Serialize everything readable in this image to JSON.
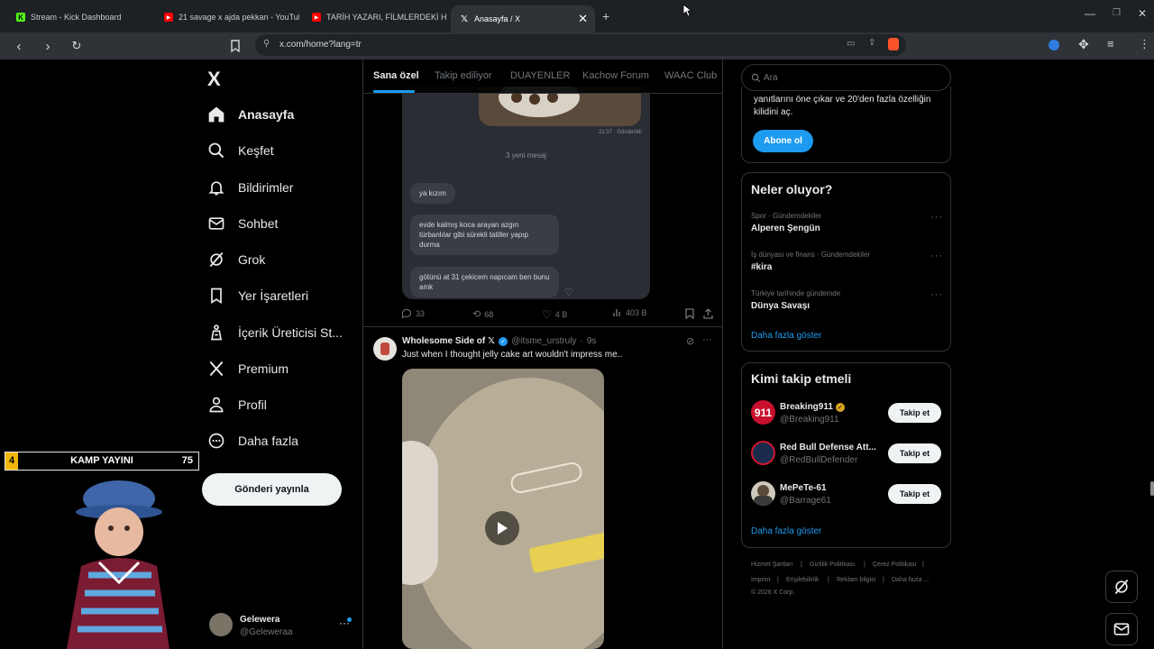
{
  "browser": {
    "tabs": [
      {
        "title": "Stream - Kick Dashboard",
        "favicon": "kick-icon"
      },
      {
        "title": "21 savage x ajda pekkan - YouTube",
        "favicon": "youtube-icon"
      },
      {
        "title": "TARİH YAZARI, FİLMLERDEKİ HİTLER",
        "favicon": "youtube-icon"
      },
      {
        "title": "Anasayfa / X",
        "favicon": "x-icon"
      }
    ],
    "url": "x.com/home?lang=tr"
  },
  "sidebar": {
    "logo": "X",
    "items": [
      {
        "label": "Anasayfa",
        "icon": "home-icon"
      },
      {
        "label": "Keşfet",
        "icon": "search-icon"
      },
      {
        "label": "Bildirimler",
        "icon": "bell-icon"
      },
      {
        "label": "Sohbet",
        "icon": "mail-icon"
      },
      {
        "label": "Grok",
        "icon": "grok-icon"
      },
      {
        "label": "Yer İşaretleri",
        "icon": "bookmark-icon"
      },
      {
        "label": "İçerik Üreticisi St...",
        "icon": "creator-icon"
      },
      {
        "label": "Premium",
        "icon": "x-icon"
      },
      {
        "label": "Profil",
        "icon": "person-icon"
      },
      {
        "label": "Daha fazla",
        "icon": "more-circle-icon"
      }
    ],
    "post_button": "Gönderi yayınla",
    "account": {
      "name": "Gelewera",
      "handle": "@Geleweraa"
    }
  },
  "overlay": {
    "banner_label": "KAMP YAYINI",
    "banner_left": "4",
    "banner_right": "75"
  },
  "feed": {
    "tabs": [
      "Sana özel",
      "Takip ediliyor",
      "DUAYENLER",
      "Kachow Forum",
      "WAAC Club"
    ],
    "post1": {
      "chat": {
        "time": "21:37 · Gönderildi",
        "new_messages": "3 yeni mesaj",
        "messages": [
          "ya kızım",
          "evde kalmış koca arayan azgın türbanlılar gibi sürekli tatiller yapıp durma",
          "götünü at 31 çekicem napıcam ben bunu amk"
        ]
      },
      "stats": {
        "replies": "33",
        "reposts": "68",
        "likes": "4 B",
        "views": "403 B"
      }
    },
    "post2": {
      "author": "Wholesome Side of 𝕏",
      "handle": "@itsme_urstruly",
      "time": "9s",
      "text": "Just when I thought jelly cake art wouldn't impress me.."
    }
  },
  "right": {
    "search_placeholder": "Ara",
    "premium": {
      "text_line1": "yanıtlarını öne çıkar ve 20'den fazla özelliğin",
      "text_line2": "kilidini aç.",
      "button": "Abone ol"
    },
    "trends": {
      "title": "Neler oluyor?",
      "items": [
        {
          "meta": "Spor · Gündemdekiler",
          "title": "Alperen Şengün"
        },
        {
          "meta": "İş dünyası ve finans · Gündemdekiler",
          "title": "#kira"
        },
        {
          "meta": "Türkiye tarihinde gündemde",
          "title": "Dünya Savaşı"
        }
      ],
      "more": "Daha fazla göster"
    },
    "who_to_follow": {
      "title": "Kimi takip etmeli",
      "items": [
        {
          "name": "Breaking911",
          "handle": "@Breaking911",
          "button": "Takip et"
        },
        {
          "name": "Red Bull Defense Att...",
          "handle": "@RedBullDefender",
          "button": "Takip et"
        },
        {
          "name": "MePeTe-61",
          "handle": "@Barrage61",
          "button": "Takip et"
        }
      ],
      "more": "Daha fazla göster"
    },
    "footer": {
      "links_row1": [
        "Hizmet Şartları",
        "Gizlilik Politikası",
        "Çerez Politikası"
      ],
      "links_row2": [
        "Imprint",
        "Erişilebilirlik",
        "Reklam bilgisi",
        "Daha fazla ..."
      ],
      "copyright": "© 2026 X Corp."
    }
  }
}
